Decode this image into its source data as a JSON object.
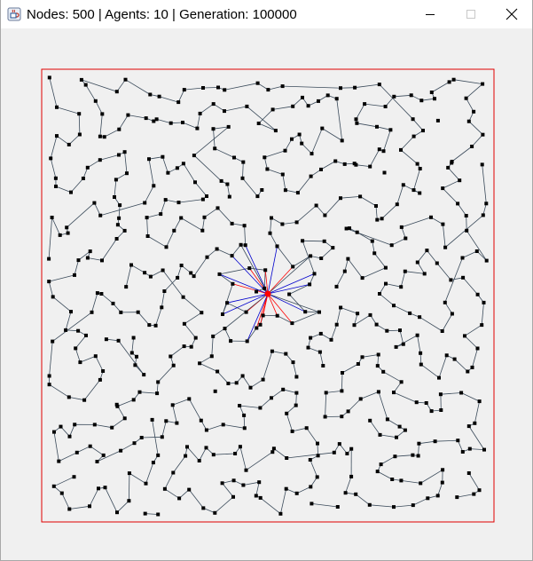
{
  "window": {
    "title": "Nodes: 500 | Agents: 10 | Generation: 100000",
    "icon": "java-icon",
    "controls": [
      "minimize-icon",
      "maximize-icon",
      "close-icon"
    ]
  },
  "colors": {
    "border": "#e00000",
    "node": "#000000",
    "edge": "#3a4a5a",
    "agent_red": "#ff0000",
    "agent_blue": "#0000cc",
    "background": "#f0f0f0"
  },
  "simulation": {
    "nodes": 500,
    "agents": 10,
    "generation": 100000
  }
}
